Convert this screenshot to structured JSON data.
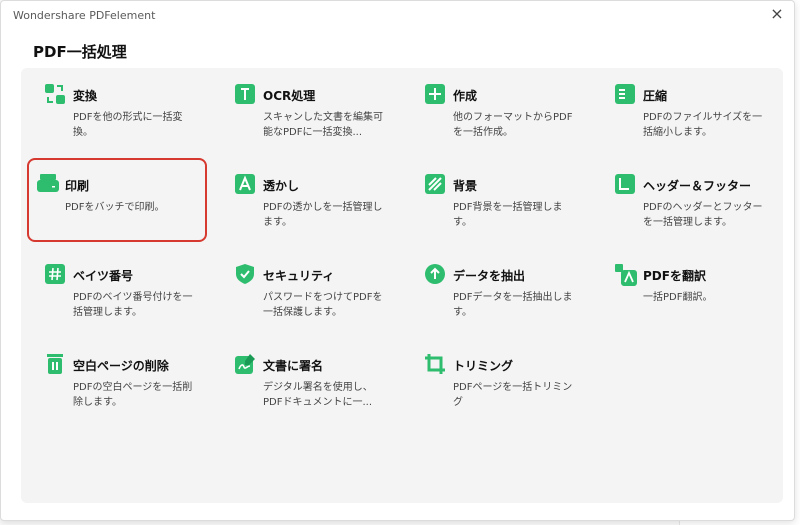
{
  "window": {
    "title": "Wondershare PDFelement",
    "close_glyph": "×"
  },
  "dialog": {
    "heading": "PDF一括処理"
  },
  "tools": [
    {
      "title": "変換",
      "desc": "PDFを他の形式に一括変換。",
      "icon": "convert-icon"
    },
    {
      "title": "OCR処理",
      "desc": "スキャンした文書を編集可能なPDFに一括変換...",
      "icon": "ocr-icon"
    },
    {
      "title": "作成",
      "desc": "他のフォーマットからPDFを一括作成。",
      "icon": "create-icon"
    },
    {
      "title": "圧縮",
      "desc": "PDFのファイルサイズを一括縮小します。",
      "icon": "compress-icon"
    },
    {
      "title": "印刷",
      "desc": "PDFをバッチで印刷。",
      "icon": "print-icon"
    },
    {
      "title": "透かし",
      "desc": "PDFの透かしを一括管理します。",
      "icon": "watermark-icon"
    },
    {
      "title": "背景",
      "desc": "PDF背景を一括管理します。",
      "icon": "background-icon"
    },
    {
      "title": "ヘッダー＆フッター",
      "desc": "PDFのヘッダーとフッターを一括管理します。",
      "icon": "header-footer-icon"
    },
    {
      "title": "ベイツ番号",
      "desc": "PDFのベイツ番号付けを一括管理します。",
      "icon": "bates-icon"
    },
    {
      "title": "セキュリティ",
      "desc": "パスワードをつけてPDFを一括保護します。",
      "icon": "security-icon"
    },
    {
      "title": "データを抽出",
      "desc": "PDFデータを一括抽出します。",
      "icon": "extract-icon"
    },
    {
      "title": "PDFを翻訳",
      "desc": "一括PDF翻訳。",
      "icon": "translate-icon"
    },
    {
      "title": "空白ページの削除",
      "desc": "PDFの空白ページを一括削除します。",
      "icon": "delete-blank-icon"
    },
    {
      "title": "文書に署名",
      "desc": "デジタル署名を使用し、PDFドキュメントに一...",
      "icon": "sign-icon"
    },
    {
      "title": "トリミング",
      "desc": "PDFページを一括トリミング",
      "icon": "crop-icon"
    }
  ],
  "selected_index": 4,
  "colors": {
    "accent_green": "#2ebd6e",
    "selection_red": "#d6392f"
  }
}
